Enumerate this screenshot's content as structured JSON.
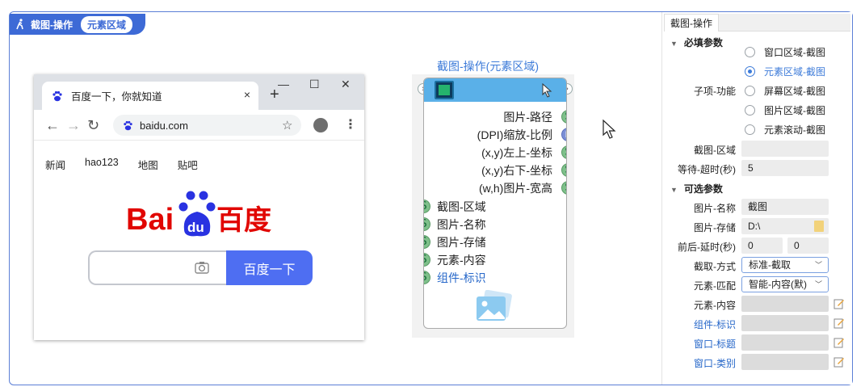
{
  "tagbar": {
    "title": "截图-操作",
    "pill": "元素区域"
  },
  "browser": {
    "tab_title": "百度一下，你就知道",
    "tab_close": "×",
    "new_tab": "+",
    "win_min": "—",
    "win_max": "☐",
    "win_close": "✕",
    "nav_back": "←",
    "nav_forward": "→",
    "nav_reload": "↻",
    "url": "baidu.com",
    "star": "☆",
    "menu": "⋮",
    "links": [
      "新闻",
      "hao123",
      "地图",
      "贴吧"
    ],
    "logo_text_left": "Bai",
    "logo_text_du": "du",
    "logo_text_right": "百度",
    "search_button": "百度一下"
  },
  "node": {
    "title": "截图-操作(元素区域)",
    "outputs": [
      {
        "label": "图片-路径",
        "type": "S"
      },
      {
        "label": "(DPI)缩放-比例",
        "type": "n"
      },
      {
        "label": "(x,y)左上-坐标",
        "type": "S"
      },
      {
        "label": "(x,y)右下-坐标",
        "type": "S"
      },
      {
        "label": "(w,h)图片-宽高",
        "type": "S"
      }
    ],
    "inputs": [
      {
        "label": "截图-区域",
        "type": "S"
      },
      {
        "label": "图片-名称",
        "type": "S"
      },
      {
        "label": "图片-存储",
        "type": "S"
      },
      {
        "label": "元素-内容",
        "type": "S"
      },
      {
        "label": "组件-标识",
        "type": "S"
      }
    ]
  },
  "panel": {
    "tab": "截图-操作",
    "required_section": "必填参数",
    "optional_section": "可选参数",
    "subfunc_label": "子项-功能",
    "radios": [
      "窗口区域-截图",
      "元素区域-截图",
      "屏幕区域-截图",
      "图片区域-截图",
      "元素滚动-截图"
    ],
    "selected_radio": 1,
    "capture_area_label": "截图-区域",
    "capture_area_value": "",
    "timeout_label": "等待-超时(秒)",
    "timeout_value": "5",
    "img_name_label": "图片-名称",
    "img_name_value": "截图",
    "img_store_label": "图片-存储",
    "img_store_value": "D:\\",
    "delay_label": "前后-延时(秒)",
    "delay_before": "0",
    "delay_after": "0",
    "capture_mode_label": "截取-方式",
    "capture_mode_value": "标准-截取",
    "match_label": "元素-匹配",
    "match_value": "智能-内容(默)",
    "elem_content_label": "元素-内容",
    "comp_id_label": "组件-标识",
    "win_title_label": "窗口-标题",
    "win_class_label": "窗口-类别"
  },
  "colors": {
    "accent": "#3d6ad6",
    "node_head": "#5ab0e8",
    "baidu_blue": "#4e6ef2",
    "baidu_red": "#e10601"
  }
}
